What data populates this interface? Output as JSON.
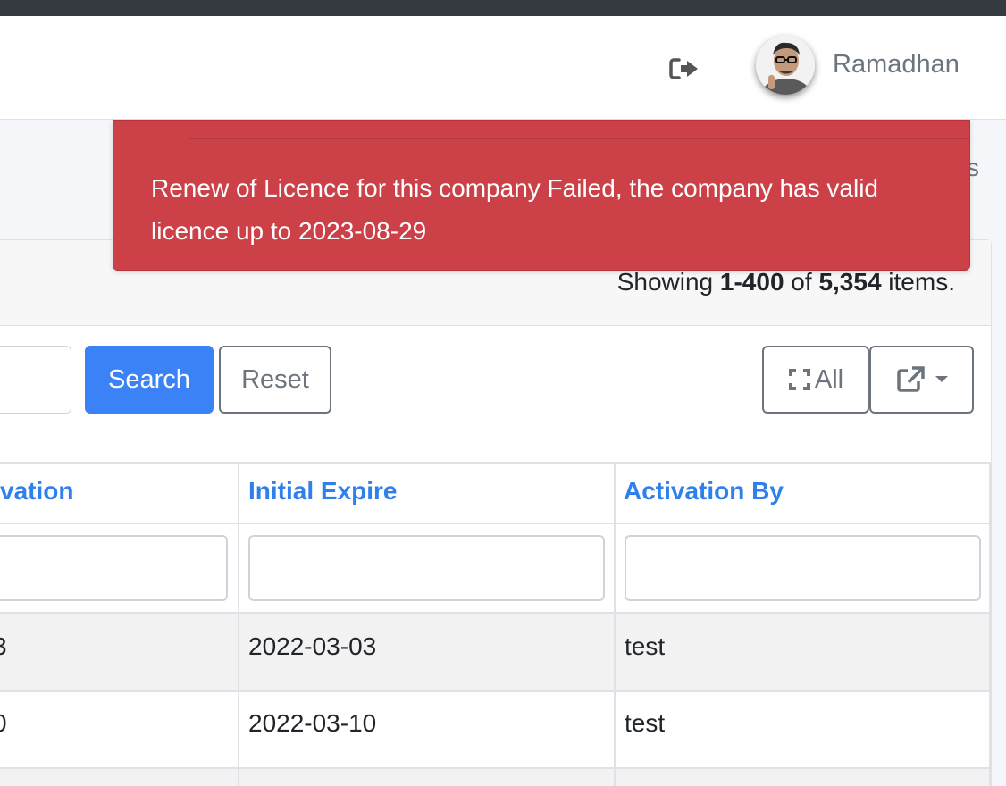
{
  "navbar": {
    "username": "Ramadhan",
    "logout_icon": "sign-out-icon",
    "avatar_icon": "user-avatar"
  },
  "page": {
    "right_edge_char": "s"
  },
  "alert": {
    "message": "Renew of Licence for this company Failed, the company has valid licence up to 2023-08-29",
    "color": "#cc4048"
  },
  "grid": {
    "summary": {
      "prefix": "Showing ",
      "range": "1-400",
      "of": " of ",
      "total": "5,354",
      "suffix": " items."
    },
    "toolbar": {
      "search_label": "Search",
      "reset_label": "Reset",
      "all_label": "All",
      "expand_icon": "expand-icon",
      "export_icon": "external-link-icon",
      "dropdown_icon": "caret-down-icon"
    },
    "columns": [
      "vation",
      "Initial Expire",
      "Activation By"
    ],
    "rows": [
      [
        "3",
        "2022-03-03",
        "test"
      ],
      [
        "0",
        "2022-03-10",
        "test"
      ]
    ]
  },
  "colors": {
    "primary": "#3b82f6",
    "link": "#2f80ed",
    "danger": "#cc4048",
    "muted": "#6c757d"
  }
}
